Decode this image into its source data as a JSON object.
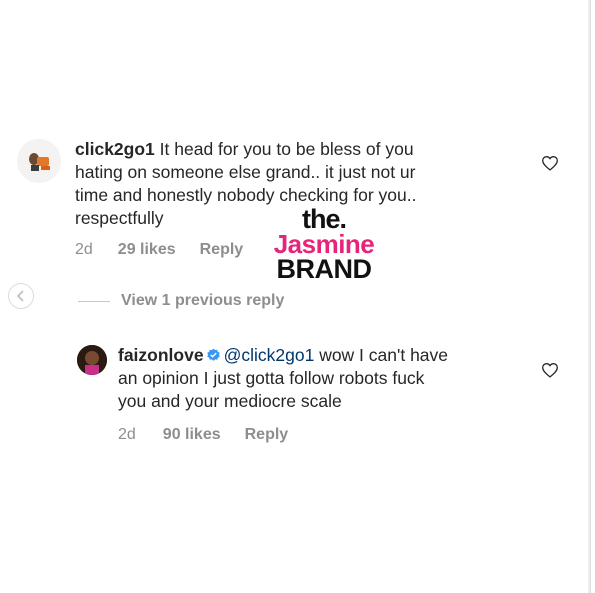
{
  "comments": [
    {
      "username": "click2go1",
      "text": "It head for you to be bless of you hating on someone else grand.. it just not ur time and honestly nobody checking for you.. respectfully",
      "line1": "It head for you to be bless of you",
      "line2": "hating on someone else grand.. it just not ur",
      "line3": "time and honestly nobody checking for you..",
      "line4": "respectfully",
      "age": "2d",
      "likes": "29 likes",
      "reply": "Reply"
    },
    {
      "username": "faizonlove",
      "verified": true,
      "mention": "@click2go1",
      "text": "wow I can't have an opinion I just gotta follow robots fuck you and your mediocre scale",
      "line1": "wow I can't have",
      "line2": "an opinion I just gotta follow robots fuck",
      "line3": "you and your mediocre scale",
      "age": "2d",
      "likes": "90 likes",
      "reply": "Reply"
    }
  ],
  "view_replies": "View 1 previous reply",
  "watermark": {
    "line1": "the.",
    "line2": "Jasmine",
    "line3": "BRAND"
  },
  "colors": {
    "text": "#262626",
    "secondary": "#8e8e8e",
    "mention": "#00376b",
    "verified": "#3897f0",
    "brand_pink": "#e6257a"
  },
  "icons": [
    "heart-icon",
    "verified-badge-icon",
    "back-arrow-icon"
  ]
}
